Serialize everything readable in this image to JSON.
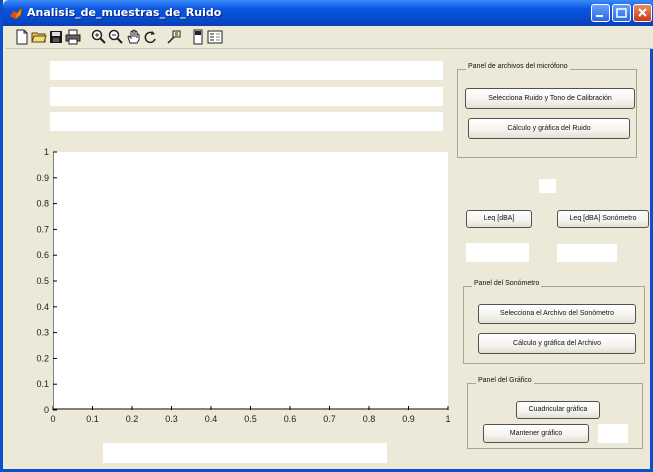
{
  "window": {
    "title": "Analisis_de_muestras_de_Ruido"
  },
  "toolbar": {
    "items": [
      "new-file",
      "open-folder",
      "save",
      "print",
      "zoom-in",
      "zoom-out",
      "pan",
      "rotate",
      "data-cursor",
      "colorbar",
      "legend"
    ]
  },
  "panels": {
    "microfono": {
      "title": "Panel de archivos del micrófono",
      "select_button": "Selecciona Ruido y Tono de Calibración",
      "calc_button": "Cálculo y gráfica del Ruido"
    },
    "leq": {
      "leq_button": "Leq [dBA]",
      "leq_sonometro_button": "Leq [dBA] Sonómetro"
    },
    "sonometro": {
      "title": "Panel del Sonómetro",
      "select_button": "Selecciona el Archivo del Sonómetro",
      "calc_button": "Cálculo y gráfica del Archivo"
    },
    "grafico": {
      "title": "Panel del Gráfico",
      "grid_button": "Cuadricular gráfica",
      "hold_button": "Mantener gráfico"
    }
  },
  "chart_data": {
    "type": "line",
    "series": [],
    "xlim": [
      0,
      1
    ],
    "ylim": [
      0,
      1
    ],
    "x_ticks": [
      "0",
      "0.1",
      "0.2",
      "0.3",
      "0.4",
      "0.5",
      "0.6",
      "0.7",
      "0.8",
      "0.9",
      "1"
    ],
    "y_ticks": [
      "0",
      "0.1",
      "0.2",
      "0.3",
      "0.4",
      "0.5",
      "0.6",
      "0.7",
      "0.8",
      "0.9",
      "1"
    ],
    "grid": false
  }
}
